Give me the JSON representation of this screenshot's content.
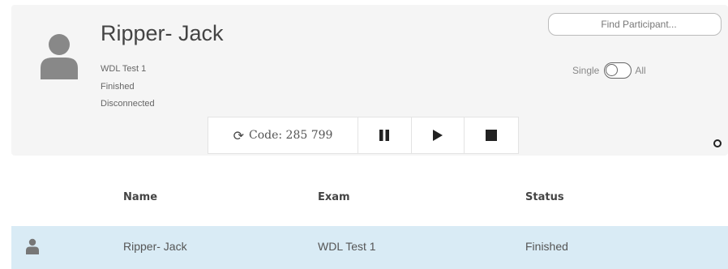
{
  "participant": {
    "name": "Ripper- Jack",
    "exam": "WDL Test 1",
    "state": "Finished",
    "connection": "Disconnected",
    "avatar_icon": "user-icon"
  },
  "search": {
    "placeholder": "Find Participant..."
  },
  "view_toggle": {
    "left_label": "Single",
    "right_label": "All"
  },
  "controls": {
    "code_label": "Code: 285 799",
    "refresh_icon": "refresh-icon",
    "pause_icon": "pause-icon",
    "play_icon": "play-icon",
    "stop_icon": "stop-icon"
  },
  "table": {
    "columns": [
      "Name",
      "Exam",
      "Status"
    ],
    "rows": [
      {
        "name": "Ripper- Jack",
        "exam": "WDL Test 1",
        "status": "Finished"
      }
    ]
  },
  "colors": {
    "selected_row": "#d9ebf5",
    "card_bg": "#f5f5f5"
  }
}
